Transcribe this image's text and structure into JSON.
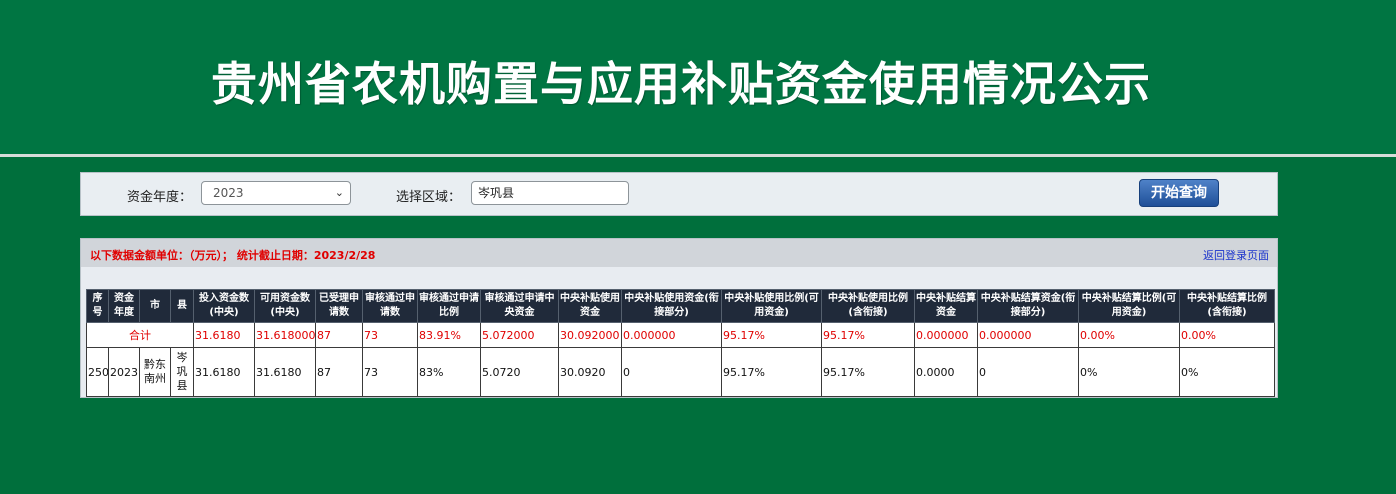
{
  "header": {
    "title": "贵州省农机购置与应用补贴资金使用情况公示"
  },
  "filter": {
    "year_label": "资金年度：",
    "year_value": "2023",
    "region_label": "选择区域：",
    "region_value": "岑巩县",
    "query_button": "开始查询"
  },
  "info": {
    "unit_text": "以下数据金额单位：（万元）；  统计截止日期：2023/2/28",
    "back_link": "返回登录页面"
  },
  "table": {
    "headers": [
      "序号",
      "资金年度",
      "市",
      "县",
      "投入资金数(中央)",
      "可用资金数(中央)",
      "已受理申请数",
      "审核通过申请数",
      "审核通过申请比例",
      "审核通过申请中央资金",
      "中央补贴使用资金",
      "中央补贴使用资金(衔接部分)",
      "中央补贴使用比例(可用资金)",
      "中央补贴使用比例(含衔接)",
      "中央补贴结算资金",
      "中央补贴结算资金(衔接部分)",
      "中央补贴结算比例(可用资金)",
      "中央补贴结算比例(含衔接)"
    ],
    "summary": {
      "label": "合计",
      "values": [
        "31.6180",
        "31.618000",
        "87",
        "73",
        "83.91%",
        "5.072000",
        "30.092000",
        "0.000000",
        "95.17%",
        "95.17%",
        "0.000000",
        "0.000000",
        "0.00%",
        "0.00%"
      ]
    },
    "rows": [
      {
        "index": "250",
        "year": "2023",
        "city": "黔东南州",
        "county": "岑巩县",
        "values": [
          "31.6180",
          "31.6180",
          "87",
          "73",
          "83%",
          "5.0720",
          "30.0920",
          "0",
          "95.17%",
          "95.17%",
          "0.0000",
          "0",
          "0%",
          "0%"
        ]
      }
    ]
  }
}
